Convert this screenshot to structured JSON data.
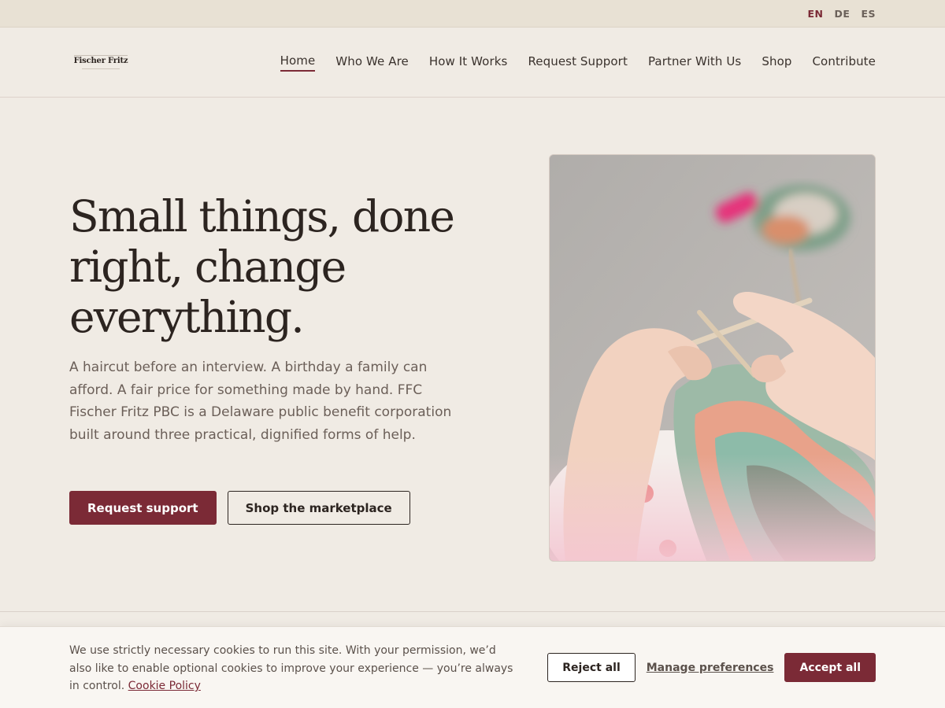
{
  "language_bar": {
    "languages": [
      {
        "code": "EN",
        "active": true
      },
      {
        "code": "DE",
        "active": false
      },
      {
        "code": "ES",
        "active": false
      }
    ]
  },
  "header": {
    "logo_text": "Fischer Fritz",
    "nav": [
      {
        "label": "Home",
        "active": true
      },
      {
        "label": "Who We Are",
        "active": false
      },
      {
        "label": "How It Works",
        "active": false
      },
      {
        "label": "Request Support",
        "active": false
      },
      {
        "label": "Partner With Us",
        "active": false
      },
      {
        "label": "Shop",
        "active": false
      },
      {
        "label": "Contribute",
        "active": false
      }
    ]
  },
  "hero": {
    "title": "Small things, done right, change everything.",
    "body": "A haircut before an interview. A birthday a family can afford. A fair price for something made by hand. FFC Fischer Fritz PBC is a Delaware public benefit corporation built around three practical, dignified forms of help.",
    "primary_cta": "Request support",
    "secondary_cta": "Shop the marketplace",
    "image_subject": "hands-knitting-photo"
  },
  "cookie_banner": {
    "text": "We use strictly necessary cookies to run this site. With your permission, we’d also like to enable optional cookies to improve your experience — you’re always in control.",
    "policy_link": "Cookie Policy",
    "reject_label": "Reject all",
    "manage_label": "Manage preferences",
    "accept_label": "Accept all"
  },
  "colors": {
    "accent": "#7b2a36",
    "background": "#f0ebe4",
    "top_bar": "#e8e1d4",
    "text": "#2c2420"
  }
}
